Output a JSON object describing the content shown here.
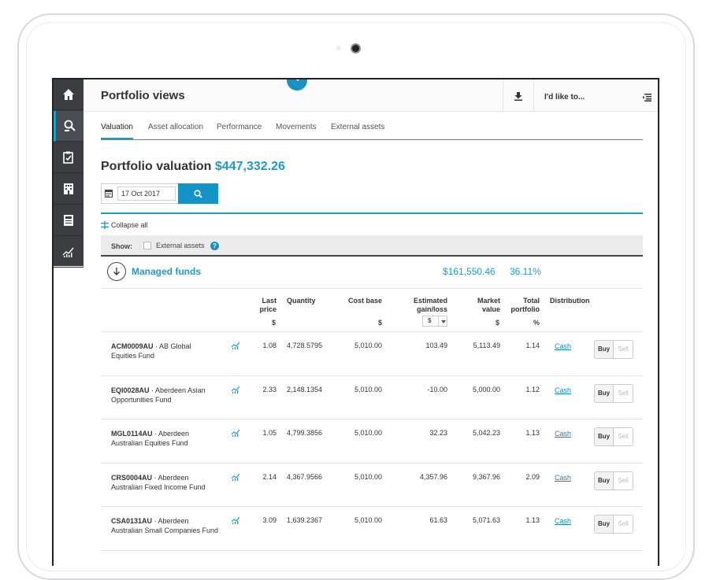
{
  "header": {
    "title": "Portfolio views",
    "ilike": "I'd like to..."
  },
  "tabs": [
    {
      "label": "Valuation",
      "active": true
    },
    {
      "label": "Asset allocation"
    },
    {
      "label": "Performance"
    },
    {
      "label": "Movements"
    },
    {
      "label": "External assets"
    }
  ],
  "valuation": {
    "title": "Portfolio valuation",
    "amount": "$447,332.26",
    "date": "17 Oct 2017"
  },
  "collapse_label": "Collapse all",
  "show": {
    "label": "Show:",
    "external_assets": "External assets",
    "help": "?"
  },
  "group": {
    "name": "Managed funds",
    "value": "$161,550.46",
    "percent": "36.11%"
  },
  "columns": {
    "last_price": "Last price",
    "quantity": "Quantity",
    "cost_base": "Cost base",
    "gain_loss": "Estimated gain/loss",
    "market_value": "Market value",
    "total_portfolio": "Total portfolio",
    "distribution": "Distribution",
    "cur_dollar": "$",
    "cur_percent": "%",
    "gain_currency": "$"
  },
  "rows": [
    {
      "code": "ACM0009AU",
      "name_a": " · AB Global",
      "name_b": "Equities Fund",
      "price": "1.08",
      "qty": "4,728.5795",
      "cost": "5,010.00",
      "gain": "103.49",
      "market": "5,113.49",
      "total": "1.14",
      "dist": "Cash",
      "buy": "Buy",
      "sell": "Sell"
    },
    {
      "code": "EQI0028AU",
      "name_a": " · Aberdeen Asian",
      "name_b": "Opportunities Fund",
      "price": "2.33",
      "qty": "2,148.1354",
      "cost": "5,010.00",
      "gain": "-10.00",
      "market": "5,000.00",
      "total": "1.12",
      "dist": "Cash",
      "buy": "Buy",
      "sell": "Sell"
    },
    {
      "code": "MGL0114AU",
      "name_a": " · Aberdeen",
      "name_b": "Australian Equities Fund",
      "price": "1.05",
      "qty": "4,799.3856",
      "cost": "5,010.00",
      "gain": "32.23",
      "market": "5,042.23",
      "total": "1.13",
      "dist": "Cash",
      "buy": "Buy",
      "sell": "Sell"
    },
    {
      "code": "CRS0004AU",
      "name_a": " · Aberdeen",
      "name_b": "Australian Fixed Income Fund",
      "price": "2.14",
      "qty": "4,367.9566",
      "cost": "5,010.00",
      "gain": "4,357.96",
      "market": "9,367.96",
      "total": "2.09",
      "dist": "Cash",
      "buy": "Buy",
      "sell": "Sell"
    },
    {
      "code": "CSA0131AU",
      "name_a": " · Aberdeen",
      "name_b": "Australian Small Companies Fund",
      "price": "3.09",
      "qty": "1,639.2367",
      "cost": "5,010.00",
      "gain": "61.63",
      "market": "5,071.63",
      "total": "1.13",
      "dist": "Cash",
      "buy": "Buy",
      "sell": "Sell"
    }
  ],
  "colors": {
    "accent": "#1a9ccd",
    "button": "#1493c6",
    "sidebar": "#3b3d40"
  }
}
